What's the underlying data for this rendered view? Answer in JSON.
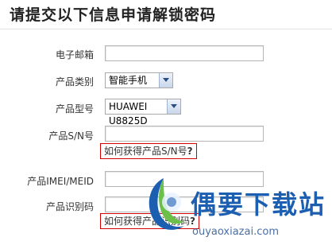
{
  "page": {
    "title": "请提交以下信息申请解锁密码"
  },
  "form": {
    "email": {
      "label": "电子邮箱",
      "value": ""
    },
    "product_category": {
      "label": "产品类别",
      "selected": "智能手机"
    },
    "product_model": {
      "label": "产品型号",
      "selected": "HUAWEI U8825D"
    },
    "product_sn": {
      "label": "产品S/N号",
      "value": "",
      "help_text": "如何获得产品S/N号",
      "help_q": "?"
    },
    "product_imei": {
      "label": "产品IMEI/MEID",
      "value": ""
    },
    "product_id_code": {
      "label": "产品识别码",
      "value": "",
      "help_text": "如何获得产品识别码",
      "help_q": "?"
    }
  },
  "watermark": {
    "name": "偶要下载站",
    "url": "ouyaoxiazai.com"
  },
  "colors": {
    "help_border": "#d40000",
    "watermark_blue": "#1c5fb1"
  }
}
